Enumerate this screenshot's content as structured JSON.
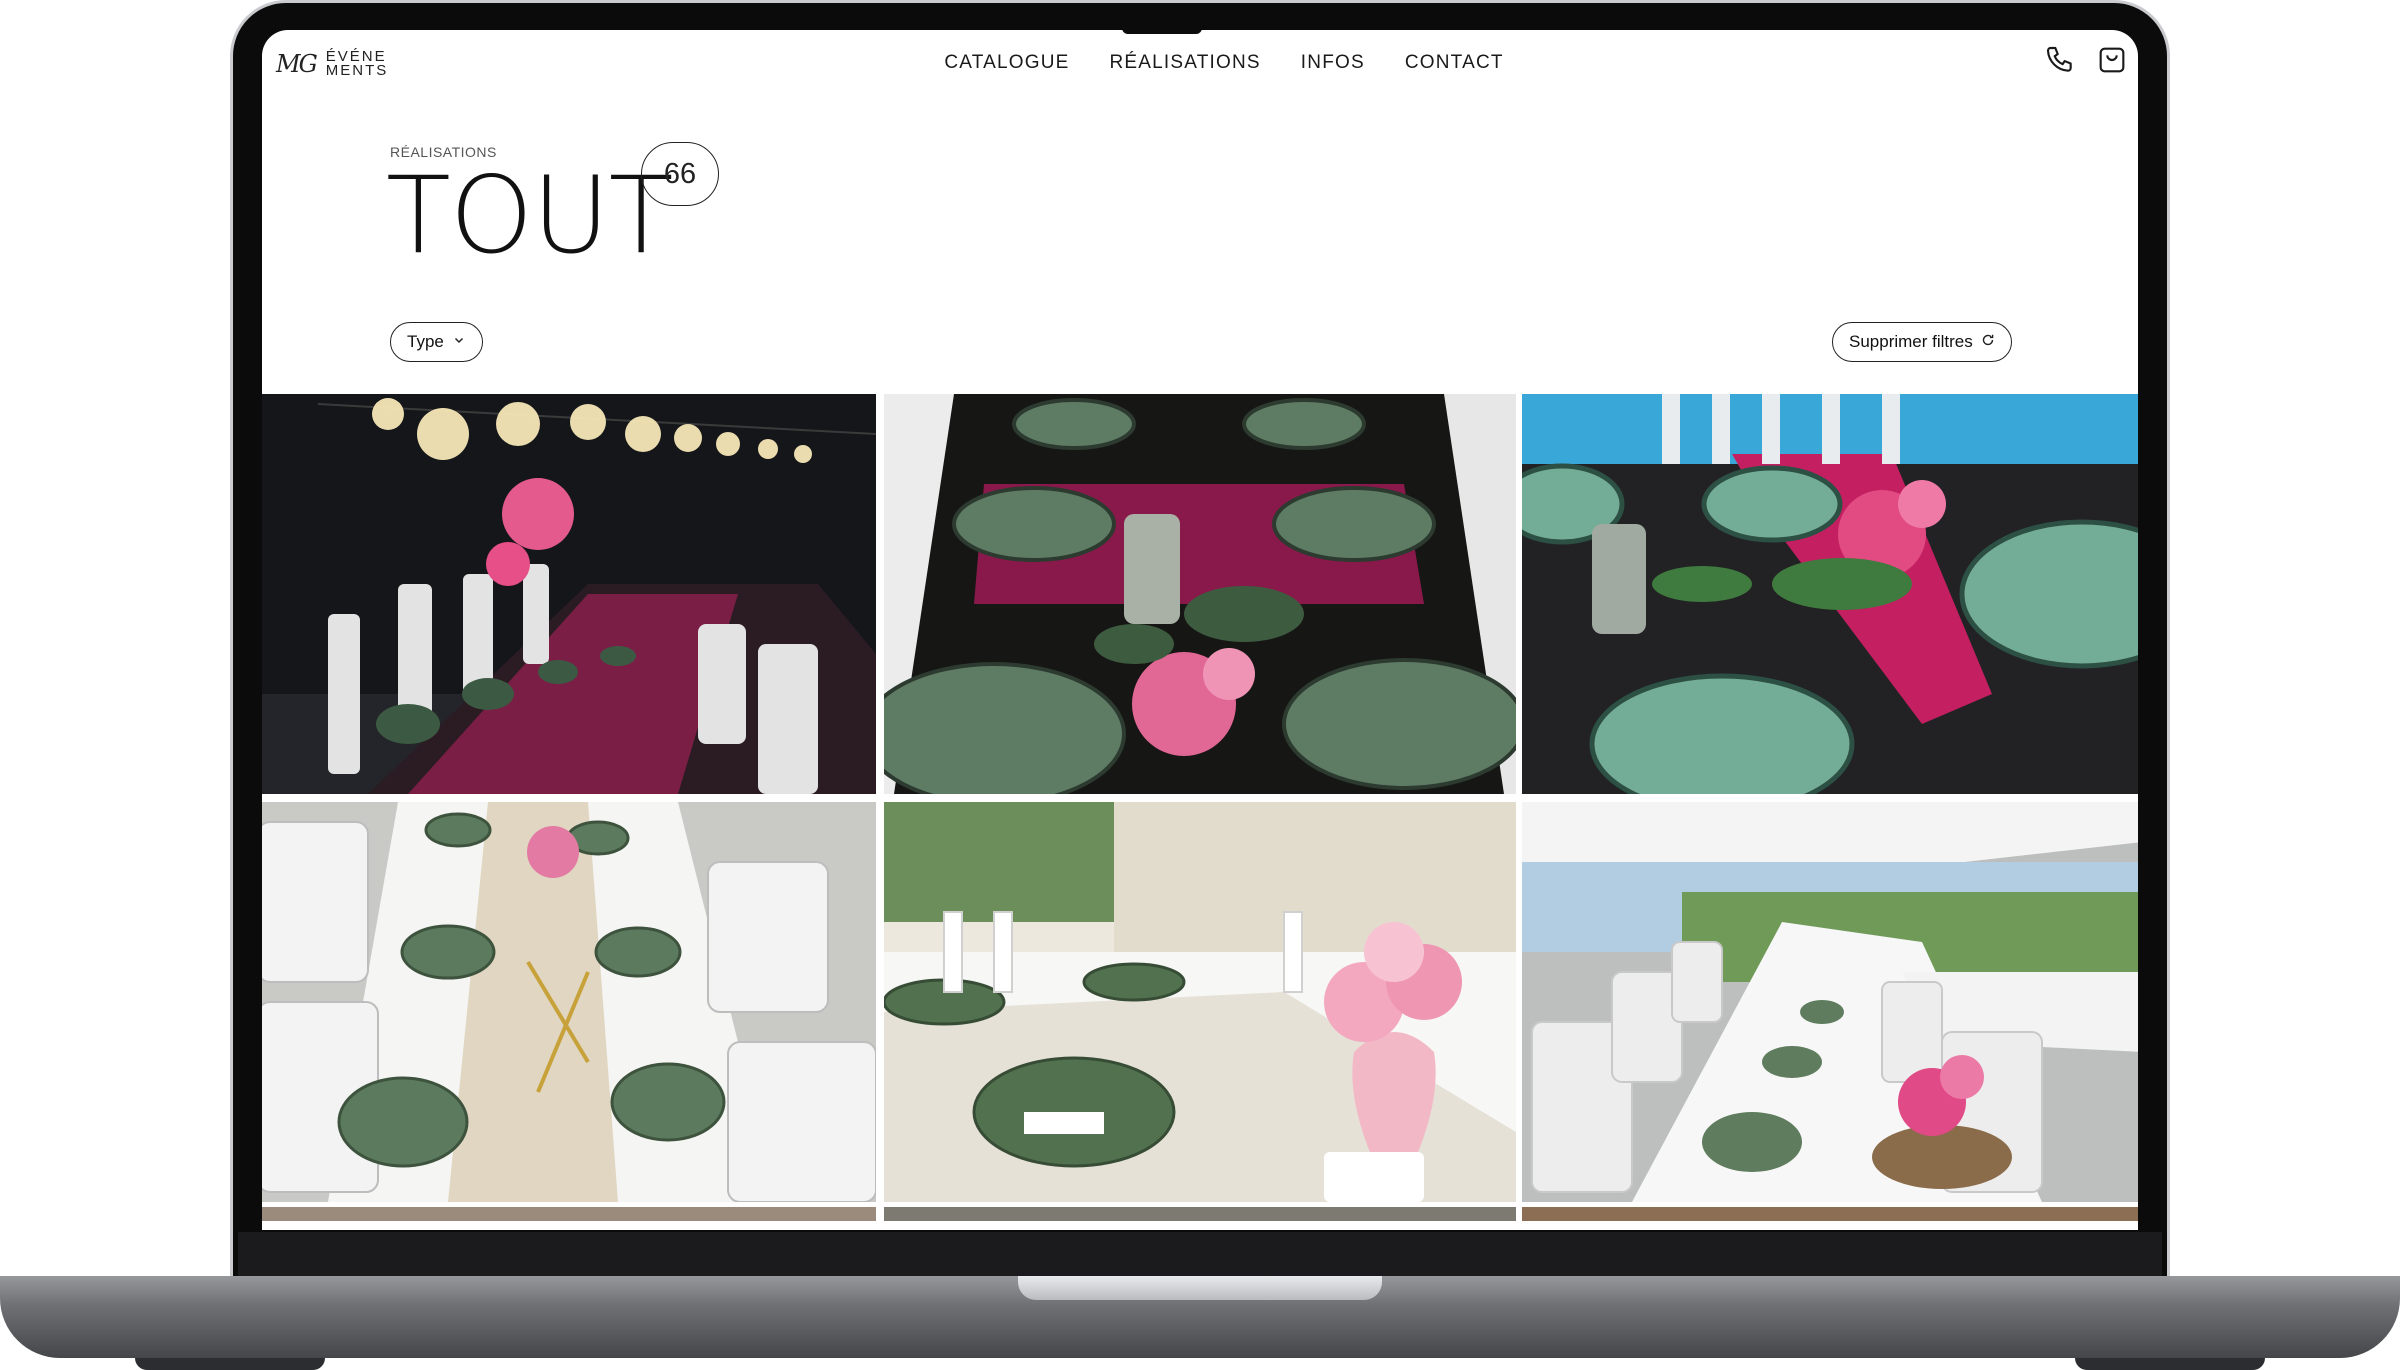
{
  "brand": {
    "mark": "MG",
    "line1": "ÉVÉNE",
    "line2": "MENTS"
  },
  "nav": [
    {
      "label": "CATALOGUE"
    },
    {
      "label": "RÉALISATIONS"
    },
    {
      "label": "INFOS"
    },
    {
      "label": "CONTACT"
    }
  ],
  "header_icons": [
    "phone-icon",
    "bag-icon"
  ],
  "page": {
    "breadcrumb": "RÉALISATIONS",
    "title": "TOUT",
    "count": "66"
  },
  "filters": {
    "type_label": "Type",
    "clear_label": "Supprimer filtres"
  },
  "gallery": [
    {
      "name": "gallery-photo-1",
      "scene": "evening table under light bulbs"
    },
    {
      "name": "gallery-photo-2",
      "scene": "green plates and candle table"
    },
    {
      "name": "gallery-photo-3",
      "scene": "pink runner by pool"
    },
    {
      "name": "gallery-photo-4",
      "scene": "white table with green plates"
    },
    {
      "name": "gallery-photo-5",
      "scene": "table with pink flowers vase"
    },
    {
      "name": "gallery-photo-6",
      "scene": "long table under white tent"
    }
  ],
  "colors": {
    "accent_pink": "#d8296f",
    "plate_green": "#5f7d5f",
    "frame": "#0b0b0c"
  }
}
